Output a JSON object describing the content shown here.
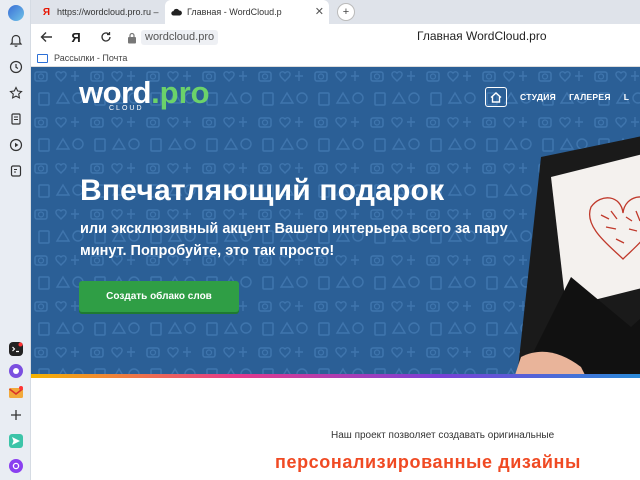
{
  "browser": {
    "tabs": [
      {
        "label": "https://wordcloud.pro.ru –"
      },
      {
        "label": "Главная - WordCloud.p"
      }
    ],
    "new_tab": "+",
    "address": {
      "url": "wordcloud.pro",
      "page_title": "Главная   WordCloud.pro"
    },
    "bookmark": {
      "label": "Рассылки - Почта"
    }
  },
  "site": {
    "logo": {
      "word": "word",
      "ext": ".pro",
      "sub": "CLOUD"
    },
    "nav": [
      "СТУДИЯ",
      "ГАЛЕРЕЯ",
      "L"
    ],
    "headline": "Впечатляющий подарок",
    "subheadline": "или эксклюзивный акцент Вашего интерьера всего за пару минут. Попробуйте, это так просто!",
    "cta_label": "Создать облако слов",
    "below_text": "Наш проект позволяет создавать оригинальные",
    "below_heading": "персонализированные дизайны"
  },
  "colors": {
    "hero_bg": "#2b5f96",
    "cta": "#2f9e45",
    "accent_green": "#6bd26a",
    "heading_orange": "#f04a23"
  }
}
